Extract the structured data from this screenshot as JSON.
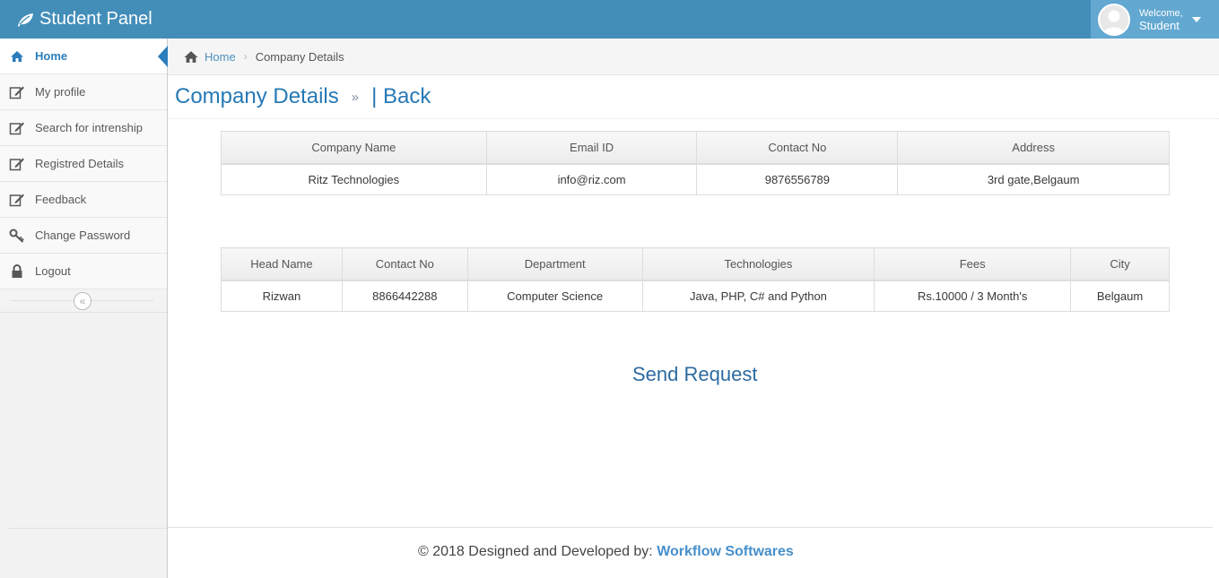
{
  "navbar": {
    "brand": "Student Panel",
    "welcome": "Welcome,",
    "user_name": "Student"
  },
  "sidebar": {
    "items": [
      {
        "label": "Home",
        "icon": "home-icon"
      },
      {
        "label": "My profile",
        "icon": "edit-icon"
      },
      {
        "label": "Search for intrenship",
        "icon": "edit-icon"
      },
      {
        "label": "Registred Details",
        "icon": "edit-icon"
      },
      {
        "label": "Feedback",
        "icon": "edit-icon"
      },
      {
        "label": "Change Password",
        "icon": "key-icon"
      },
      {
        "label": "Logout",
        "icon": "lock-icon"
      }
    ],
    "collapse_symbol": "«"
  },
  "breadcrumb": {
    "home": "Home",
    "current": "Company Details"
  },
  "page_header": {
    "title": "Company Details",
    "raquo": "»",
    "back": "| Back"
  },
  "company_table": {
    "headers": [
      "Company Name",
      "Email ID",
      "Contact No",
      "Address"
    ],
    "row": [
      "Ritz Technologies",
      "info@riz.com",
      "9876556789",
      "3rd gate,Belgaum"
    ]
  },
  "head_table": {
    "headers": [
      "Head Name",
      "Contact No",
      "Department",
      "Technologies",
      "Fees",
      "City"
    ],
    "row": [
      "Rizwan",
      "8866442288",
      "Computer Science",
      "Java, PHP, C# and Python",
      "Rs.10000 / 3 Month's",
      "Belgaum"
    ]
  },
  "actions": {
    "send_request": "Send Request"
  },
  "footer": {
    "text": "© 2018 Designed and Developed by: ",
    "company": "Workflow Softwares"
  },
  "colors": {
    "navbar": "#438eb9",
    "accent": "#2679b5",
    "link": "#4c8fbd"
  }
}
